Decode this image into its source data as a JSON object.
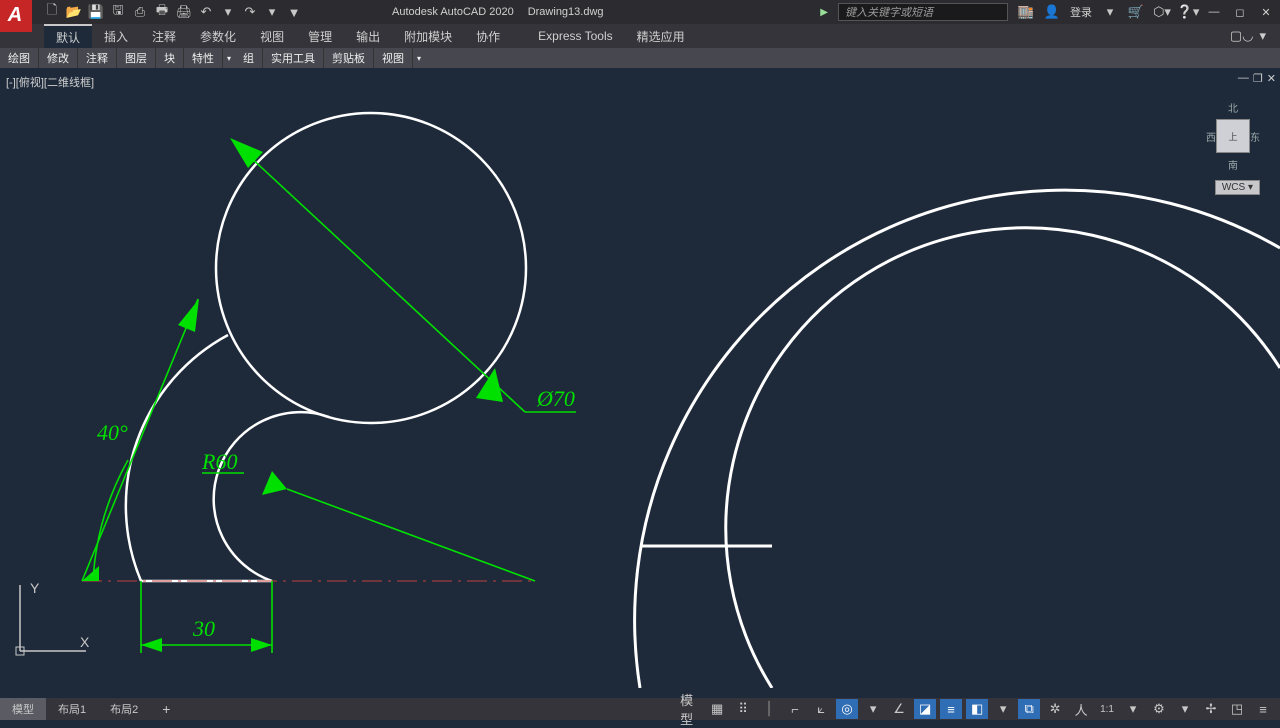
{
  "app": {
    "title": "Autodesk AutoCAD 2020",
    "file": "Drawing13.dwg"
  },
  "search": {
    "placeholder": "键入关键字或短语"
  },
  "login": {
    "label": "登录"
  },
  "qat": {
    "undo": "↶",
    "redo": "↷"
  },
  "menu": {
    "items": [
      "默认",
      "插入",
      "注释",
      "参数化",
      "视图",
      "管理",
      "输出",
      "附加模块",
      "协作",
      "Express Tools",
      "精选应用"
    ],
    "selected": 0
  },
  "panels": [
    "绘图",
    "修改",
    "注释",
    "图层",
    "块",
    "特性",
    "组",
    "实用工具",
    "剪贴板",
    "视图"
  ],
  "viewport": {
    "control": "[-][俯视][二维线框]"
  },
  "viewcube": {
    "n": "北",
    "s": "南",
    "e": "东",
    "w": "西",
    "face": "上"
  },
  "wcs": "WCS",
  "ucs": {
    "x": "X",
    "y": "Y"
  },
  "dims": {
    "angle": "40°",
    "radius": "R60",
    "dia": "Ø70",
    "width": "30"
  },
  "layouts": {
    "tabs": [
      "模型",
      "布局1",
      "布局2"
    ],
    "active": 0,
    "plus": "+"
  },
  "status": {
    "modelBtn": "模型",
    "scale": "1:1"
  }
}
